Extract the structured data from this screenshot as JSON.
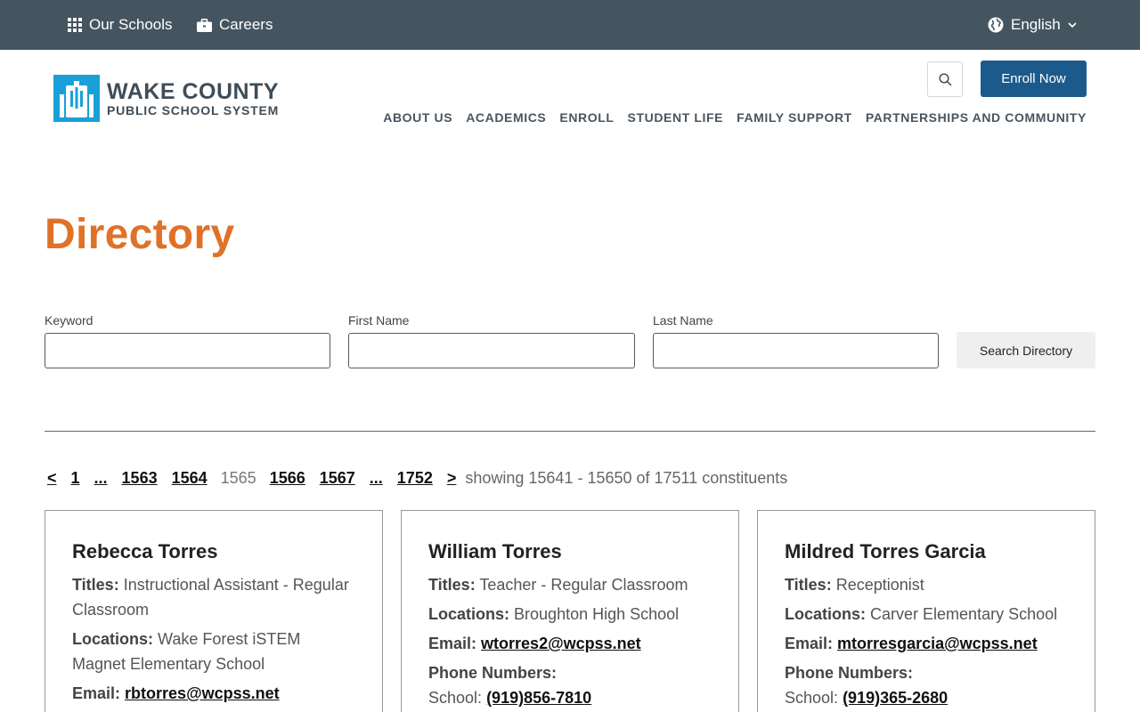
{
  "topbar": {
    "schools_label": "Our Schools",
    "careers_label": "Careers",
    "language_label": "English"
  },
  "logo": {
    "line1": "WAKE COUNTY",
    "line2": "PUBLIC SCHOOL SYSTEM"
  },
  "header": {
    "enroll_label": "Enroll Now",
    "nav": [
      {
        "label": "ABOUT US"
      },
      {
        "label": "ACADEMICS"
      },
      {
        "label": "ENROLL"
      },
      {
        "label": "STUDENT LIFE"
      },
      {
        "label": "FAMILY SUPPORT"
      },
      {
        "label": "PARTNERSHIPS AND COMMUNITY"
      }
    ]
  },
  "page": {
    "title": "Directory"
  },
  "search": {
    "keyword_label": "Keyword",
    "keyword_value": "",
    "first_name_label": "First Name",
    "first_name_value": "",
    "last_name_label": "Last Name",
    "last_name_value": "",
    "button_label": "Search Directory"
  },
  "pagination": {
    "prev": "<",
    "first": "1",
    "ellipsis1": "...",
    "p1563": "1563",
    "p1564": "1564",
    "current": "1565",
    "p1566": "1566",
    "p1567": "1567",
    "ellipsis2": "...",
    "last": "1752",
    "next": ">",
    "showing": "showing 15641 - 15650 of 17511 constituents"
  },
  "labels": {
    "titles": "Titles:",
    "locations": "Locations:",
    "email": "Email:",
    "phones": "Phone Numbers:",
    "school": "School:"
  },
  "people": [
    {
      "name": "Rebecca Torres",
      "title": "Instructional Assistant - Regular Classroom",
      "location": "Wake Forest iSTEM Magnet Elementary School",
      "email": "rbtorres@wcpss.net"
    },
    {
      "name": "William Torres",
      "title": "Teacher - Regular Classroom",
      "location": "Broughton High School",
      "email": "wtorres2@wcpss.net",
      "phone": "(919)856-7810"
    },
    {
      "name": "Mildred Torres Garcia",
      "title": "Receptionist",
      "location": "Carver Elementary School",
      "email": "mtorresgarcia@wcpss.net",
      "phone": "(919)365-2680"
    }
  ],
  "colors": {
    "topbar": "#455560",
    "brand_blue": "#1c5a8c",
    "logo_cyan": "#1aa0d8",
    "title_orange": "#e07228"
  },
  "icons": {
    "schools": "grid-icon",
    "careers": "briefcase-icon",
    "language": "globe-icon",
    "search": "search-icon"
  }
}
